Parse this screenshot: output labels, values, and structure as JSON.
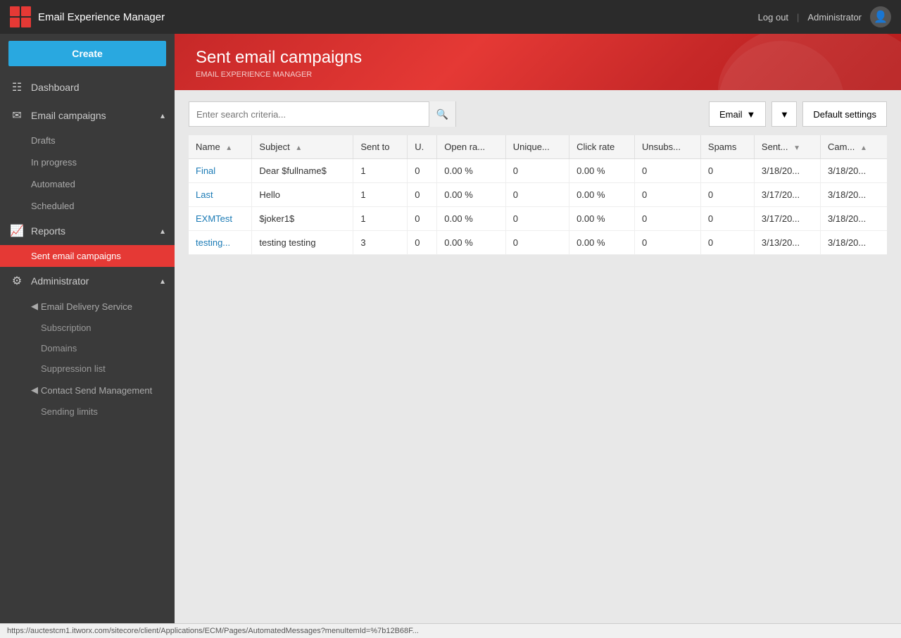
{
  "topbar": {
    "app_title": "Email Experience Manager",
    "logout_label": "Log out",
    "admin_label": "Administrator"
  },
  "sidebar": {
    "create_label": "Create",
    "nav": [
      {
        "id": "dashboard",
        "label": "Dashboard",
        "icon": "📊",
        "type": "item"
      },
      {
        "id": "email-campaigns",
        "label": "Email campaigns",
        "icon": "✉",
        "type": "section",
        "expanded": true,
        "children": [
          {
            "id": "drafts",
            "label": "Drafts"
          },
          {
            "id": "in-progress",
            "label": "In progress"
          },
          {
            "id": "automated",
            "label": "Automated"
          },
          {
            "id": "scheduled",
            "label": "Scheduled"
          }
        ]
      },
      {
        "id": "reports",
        "label": "Reports",
        "icon": "📈",
        "type": "section",
        "expanded": true,
        "children": [
          {
            "id": "sent-email-campaigns",
            "label": "Sent email campaigns",
            "active": true
          }
        ]
      },
      {
        "id": "administrator",
        "label": "Administrator",
        "icon": "⚙",
        "type": "section",
        "expanded": true,
        "children": [
          {
            "id": "email-delivery-service",
            "label": "Email Delivery Service",
            "type": "subsection",
            "children": [
              {
                "id": "subscription",
                "label": "Subscription"
              },
              {
                "id": "domains",
                "label": "Domains"
              },
              {
                "id": "suppression-list",
                "label": "Suppression list"
              }
            ]
          },
          {
            "id": "contact-send-management",
            "label": "Contact Send Management",
            "type": "subsection",
            "children": [
              {
                "id": "sending-limits",
                "label": "Sending limits"
              }
            ]
          }
        ]
      }
    ]
  },
  "page_header": {
    "title": "Sent email campaigns",
    "breadcrumb": "EMAIL EXPERIENCE MANAGER"
  },
  "toolbar": {
    "search_placeholder": "Enter search criteria...",
    "email_filter_label": "Email",
    "default_settings_label": "Default settings"
  },
  "table": {
    "columns": [
      {
        "id": "name",
        "label": "Name",
        "sort": "asc"
      },
      {
        "id": "subject",
        "label": "Subject",
        "sort": "asc"
      },
      {
        "id": "sent_to",
        "label": "Sent to",
        "sort": null
      },
      {
        "id": "u",
        "label": "U.",
        "sort": null
      },
      {
        "id": "open_rate",
        "label": "Open ra...",
        "sort": null
      },
      {
        "id": "unique",
        "label": "Unique...",
        "sort": null
      },
      {
        "id": "click_rate",
        "label": "Click rate",
        "sort": null
      },
      {
        "id": "unsubs",
        "label": "Unsubs...",
        "sort": null
      },
      {
        "id": "spams",
        "label": "Spams",
        "sort": null
      },
      {
        "id": "sent",
        "label": "Sent...",
        "sort": "desc"
      },
      {
        "id": "cam",
        "label": "Cam...",
        "sort": "asc"
      }
    ],
    "rows": [
      {
        "name": "Final",
        "name_link": true,
        "subject": "Dear $fullname$",
        "sent_to": "1",
        "u": "0",
        "open_rate": "0.00 %",
        "unique": "0",
        "click_rate": "0.00 %",
        "unsubs": "0",
        "spams": "0",
        "sent": "3/18/20...",
        "cam": "3/18/20..."
      },
      {
        "name": "Last",
        "name_link": true,
        "subject": "Hello",
        "sent_to": "1",
        "u": "0",
        "open_rate": "0.00 %",
        "unique": "0",
        "click_rate": "0.00 %",
        "unsubs": "0",
        "spams": "0",
        "sent": "3/17/20...",
        "cam": "3/18/20..."
      },
      {
        "name": "EXMTest",
        "name_link": true,
        "subject": "$joker1$",
        "sent_to": "1",
        "u": "0",
        "open_rate": "0.00 %",
        "unique": "0",
        "click_rate": "0.00 %",
        "unsubs": "0",
        "spams": "0",
        "sent": "3/17/20...",
        "cam": "3/18/20..."
      },
      {
        "name": "testing...",
        "name_link": true,
        "subject": "testing testing",
        "sent_to": "3",
        "u": "0",
        "open_rate": "0.00 %",
        "unique": "0",
        "click_rate": "0.00 %",
        "unsubs": "0",
        "spams": "0",
        "sent": "3/13/20...",
        "cam": "3/18/20..."
      }
    ]
  },
  "statusbar": {
    "url": "https://auctestcm1.itworx.com/sitecore/client/Applications/ECM/Pages/AutomatedMessages?menuItemId=%7b12B68F..."
  }
}
